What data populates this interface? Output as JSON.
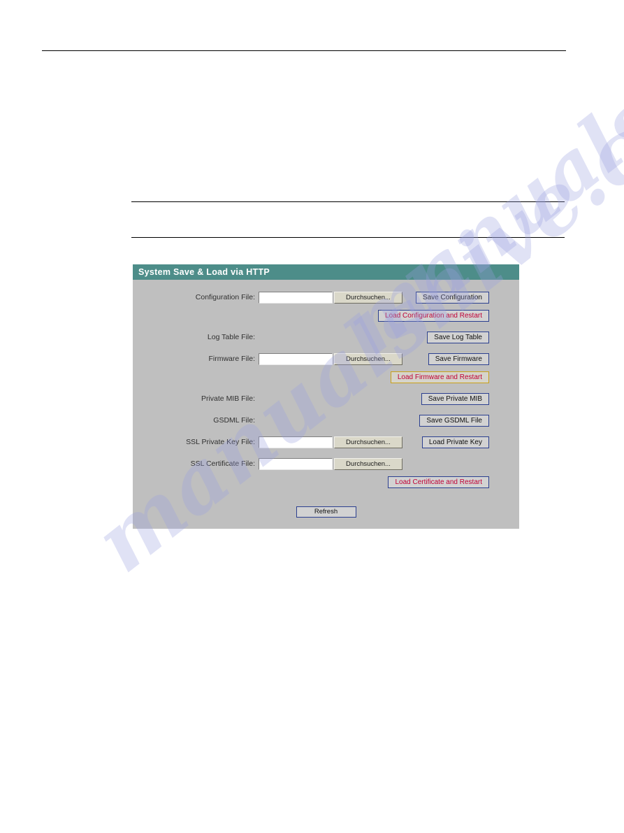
{
  "page": {
    "rules": [
      "top-rule",
      "section-rule-1",
      "section-rule-2"
    ],
    "watermark_text": "manualshive.com"
  },
  "panel": {
    "title": "System Save & Load via HTTP",
    "header_color": "#4d8d89",
    "body_color": "#bfbfbf",
    "browse_label": "Durchsuchen...",
    "rows": [
      {
        "label": "Configuration File:",
        "has_file_input": true,
        "input_value": "",
        "action_label": "Save Configuration",
        "action_kind": "save"
      },
      {
        "label": "",
        "has_file_input": false,
        "input_value": "",
        "action_label": "Load Configuration and Restart",
        "action_kind": "load"
      },
      {
        "label": "Log Table File:",
        "has_file_input": false,
        "input_value": "",
        "action_label": "Save Log Table",
        "action_kind": "save"
      },
      {
        "label": "Firmware File:",
        "has_file_input": true,
        "input_value": "",
        "action_label": "Save Firmware",
        "action_kind": "save"
      },
      {
        "label": "",
        "has_file_input": false,
        "input_value": "",
        "action_label": "Load Firmware and Restart",
        "action_kind": "load-focused"
      },
      {
        "label": "Private MIB File:",
        "has_file_input": false,
        "input_value": "",
        "action_label": "Save Private MIB",
        "action_kind": "save"
      },
      {
        "label": "GSDML File:",
        "has_file_input": false,
        "input_value": "",
        "action_label": "Save GSDML File",
        "action_kind": "save"
      },
      {
        "label": "SSL Private Key File:",
        "has_file_input": true,
        "input_value": "",
        "action_label": "Load Private Key",
        "action_kind": "save"
      },
      {
        "label": "SSL Certificate File:",
        "has_file_input": true,
        "input_value": "",
        "action_label": "",
        "action_kind": "none"
      },
      {
        "label": "",
        "has_file_input": false,
        "input_value": "",
        "action_label": "Load Certificate and Restart",
        "action_kind": "load"
      }
    ],
    "refresh_label": "Refresh"
  }
}
